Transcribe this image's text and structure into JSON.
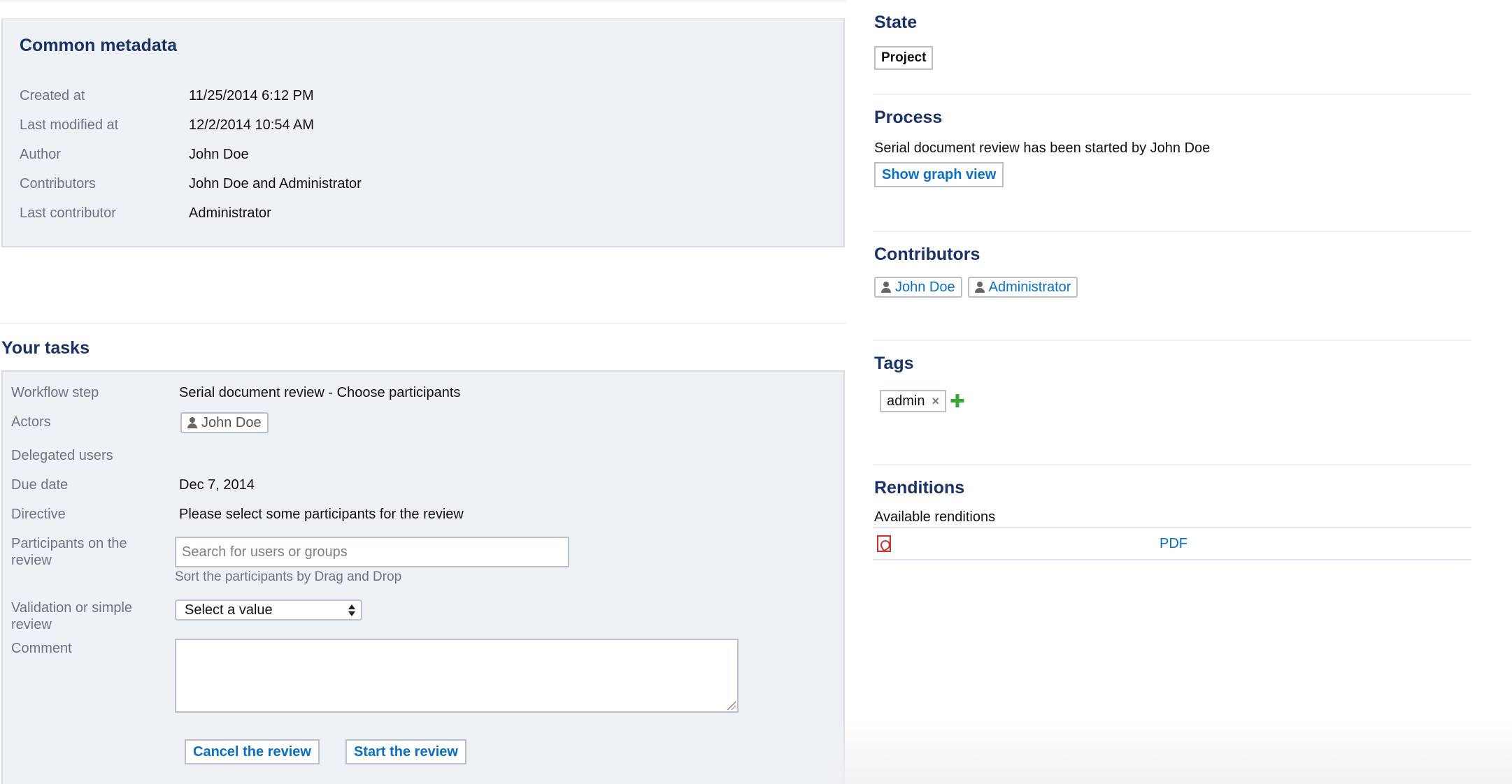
{
  "common_metadata": {
    "title": "Common metadata",
    "rows": [
      {
        "label": "Created at",
        "value": "11/25/2014 6:12 PM"
      },
      {
        "label": "Last modified at",
        "value": "12/2/2014 10:54 AM"
      },
      {
        "label": "Author",
        "value": "John Doe"
      },
      {
        "label": "Contributors",
        "value": "John Doe and Administrator"
      },
      {
        "label": "Last contributor",
        "value": "Administrator"
      }
    ]
  },
  "tasks": {
    "title": "Your tasks",
    "workflow_step": {
      "label": "Workflow step",
      "value": "Serial document review - Choose participants"
    },
    "actors": {
      "label": "Actors",
      "user": "John Doe"
    },
    "delegated_users": {
      "label": "Delegated users"
    },
    "due_date": {
      "label": "Due date",
      "value": "Dec 7, 2014"
    },
    "directive": {
      "label": "Directive",
      "value": "Please select some participants for the review"
    },
    "participants": {
      "label": "Participants on the review",
      "placeholder": "Search for users or groups",
      "hint": "Sort the participants by Drag and Drop"
    },
    "validation": {
      "label": "Validation or simple review",
      "selected": "Select a value"
    },
    "comment": {
      "label": "Comment"
    },
    "cancel_label": "Cancel the review",
    "start_label": "Start the review"
  },
  "state": {
    "title": "State",
    "value": "Project"
  },
  "process": {
    "title": "Process",
    "text": "Serial document review has been started by John Doe",
    "graph_button": "Show graph view"
  },
  "contributors": {
    "title": "Contributors",
    "users": [
      "John Doe",
      "Administrator"
    ]
  },
  "tags": {
    "title": "Tags",
    "items": [
      "admin"
    ],
    "remove_glyph": "×",
    "add_glyph": "✚"
  },
  "renditions": {
    "title": "Renditions",
    "subtitle": "Available renditions",
    "items": [
      {
        "name": "PDF",
        "icon": "pdf-icon"
      }
    ]
  },
  "colors": {
    "heading": "#1b3266",
    "link": "#0a6fc2",
    "panel": "#eef2f7",
    "add": "#3aa63a",
    "pdf": "#c9302c"
  }
}
